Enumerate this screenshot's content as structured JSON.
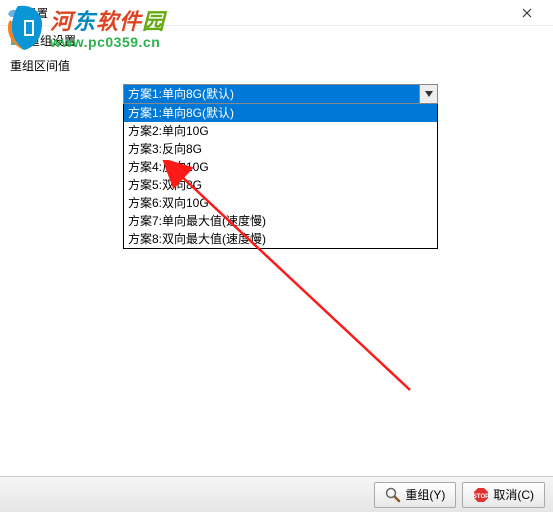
{
  "window": {
    "title": "设置"
  },
  "section": {
    "header": "重组设置",
    "interval_label": "重组区间值"
  },
  "combo": {
    "selected": "方案1:单向8G(默认)",
    "options": [
      "方案1:单向8G(默认)",
      "方案2:单向10G",
      "方案3:反向8G",
      "方案4:反向10G",
      "方案5:双向8G",
      "方案6:双向10G",
      "方案7:单向最大值(速度慢)",
      "方案8:双向最大值(速度慢)"
    ],
    "highlighted_index": 0
  },
  "buttons": {
    "regroup": "重组(Y)",
    "cancel": "取消(C)"
  },
  "watermark": {
    "site_name_chars": [
      "河",
      "东",
      "软",
      "件",
      "园"
    ],
    "url": "www.pc0359.cn"
  },
  "icons": {
    "title": "settings-bird-icon",
    "section": "regroup-icon",
    "regroup_btn": "magnifier-icon",
    "cancel_btn": "stop-icon",
    "close": "close-icon",
    "dropdown": "chevron-down-icon"
  }
}
